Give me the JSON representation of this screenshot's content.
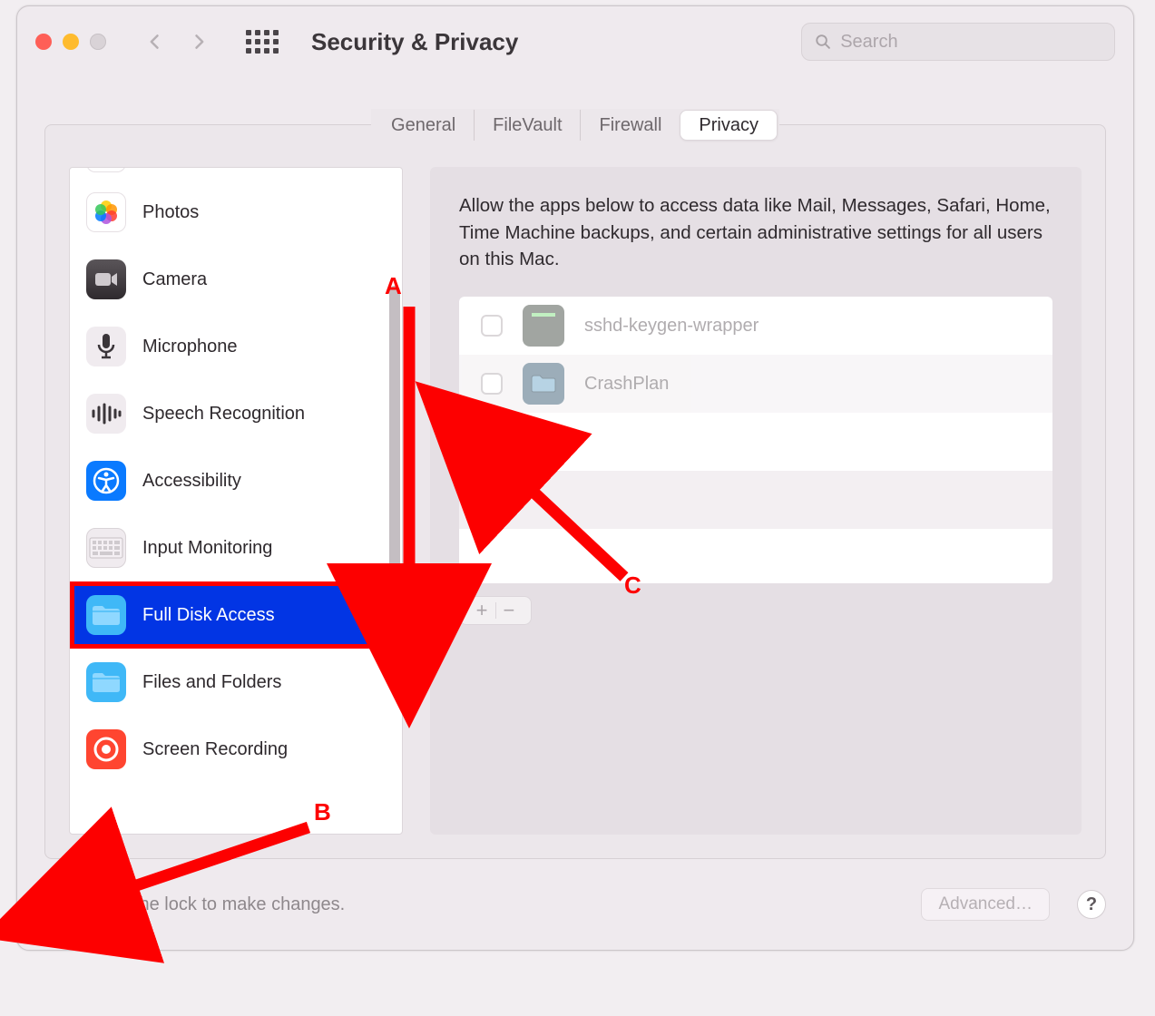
{
  "window": {
    "title": "Security & Privacy"
  },
  "search": {
    "placeholder": "Search",
    "value": ""
  },
  "tabs": [
    {
      "id": "general",
      "label": "General",
      "active": false
    },
    {
      "id": "filevault",
      "label": "FileVault",
      "active": false
    },
    {
      "id": "firewall",
      "label": "Firewall",
      "active": false
    },
    {
      "id": "privacy",
      "label": "Privacy",
      "active": true
    }
  ],
  "sidebar": {
    "items": [
      {
        "id": "photos",
        "label": "Photos",
        "selected": false
      },
      {
        "id": "camera",
        "label": "Camera",
        "selected": false
      },
      {
        "id": "microphone",
        "label": "Microphone",
        "selected": false
      },
      {
        "id": "speech",
        "label": "Speech Recognition",
        "selected": false
      },
      {
        "id": "accessibility",
        "label": "Accessibility",
        "selected": false
      },
      {
        "id": "inputmon",
        "label": "Input Monitoring",
        "selected": false
      },
      {
        "id": "fulldisk",
        "label": "Full Disk Access",
        "selected": true
      },
      {
        "id": "filesfolders",
        "label": "Files and Folders",
        "selected": false
      },
      {
        "id": "screenrec",
        "label": "Screen Recording",
        "selected": false
      }
    ]
  },
  "main": {
    "description": "Allow the apps below to access data like Mail, Messages, Safari, Home, Time Machine backups, and certain administrative settings for all users on this Mac.",
    "apps": [
      {
        "id": "sshd",
        "label": "sshd-keygen-wrapper",
        "checked": false,
        "enabled": false
      },
      {
        "id": "crashplan",
        "label": "CrashPlan",
        "checked": false,
        "enabled": false
      }
    ]
  },
  "footer": {
    "lock_text": "Click the lock to make changes.",
    "advanced_label": "Advanced…"
  },
  "annotations": {
    "A": "A",
    "B": "B",
    "C": "C"
  }
}
